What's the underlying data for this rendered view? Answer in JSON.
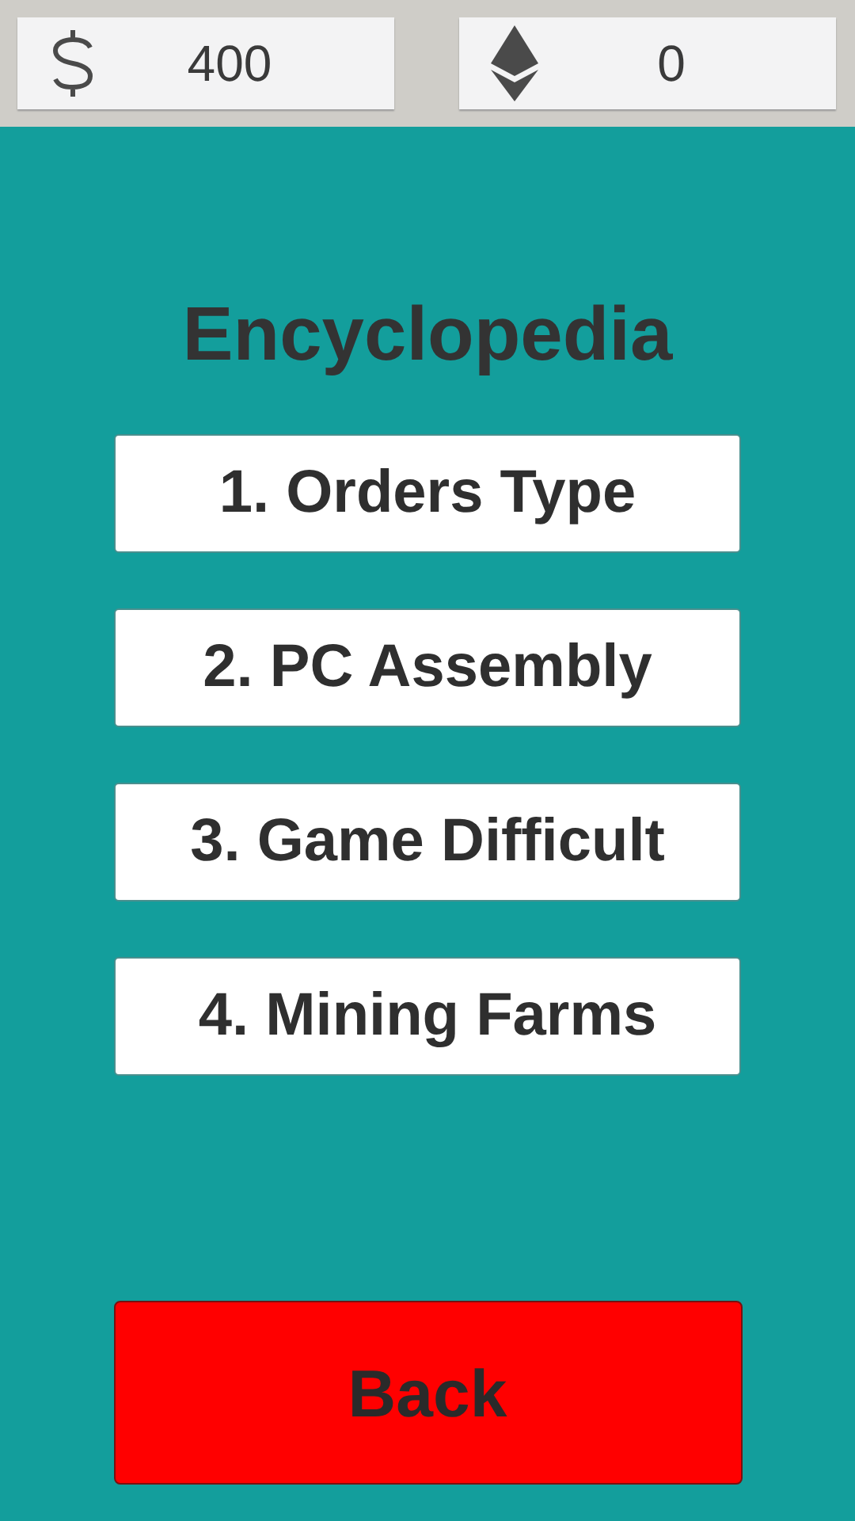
{
  "currencies": [
    {
      "kind": "dollar",
      "amount": "400"
    },
    {
      "kind": "ether",
      "amount": "0"
    }
  ],
  "title": "Encyclopedia",
  "entries": [
    "1. Orders Type",
    "2. PC Assembly",
    "3. Game Difficult",
    "4. Mining Farms"
  ],
  "back_button": "Back"
}
